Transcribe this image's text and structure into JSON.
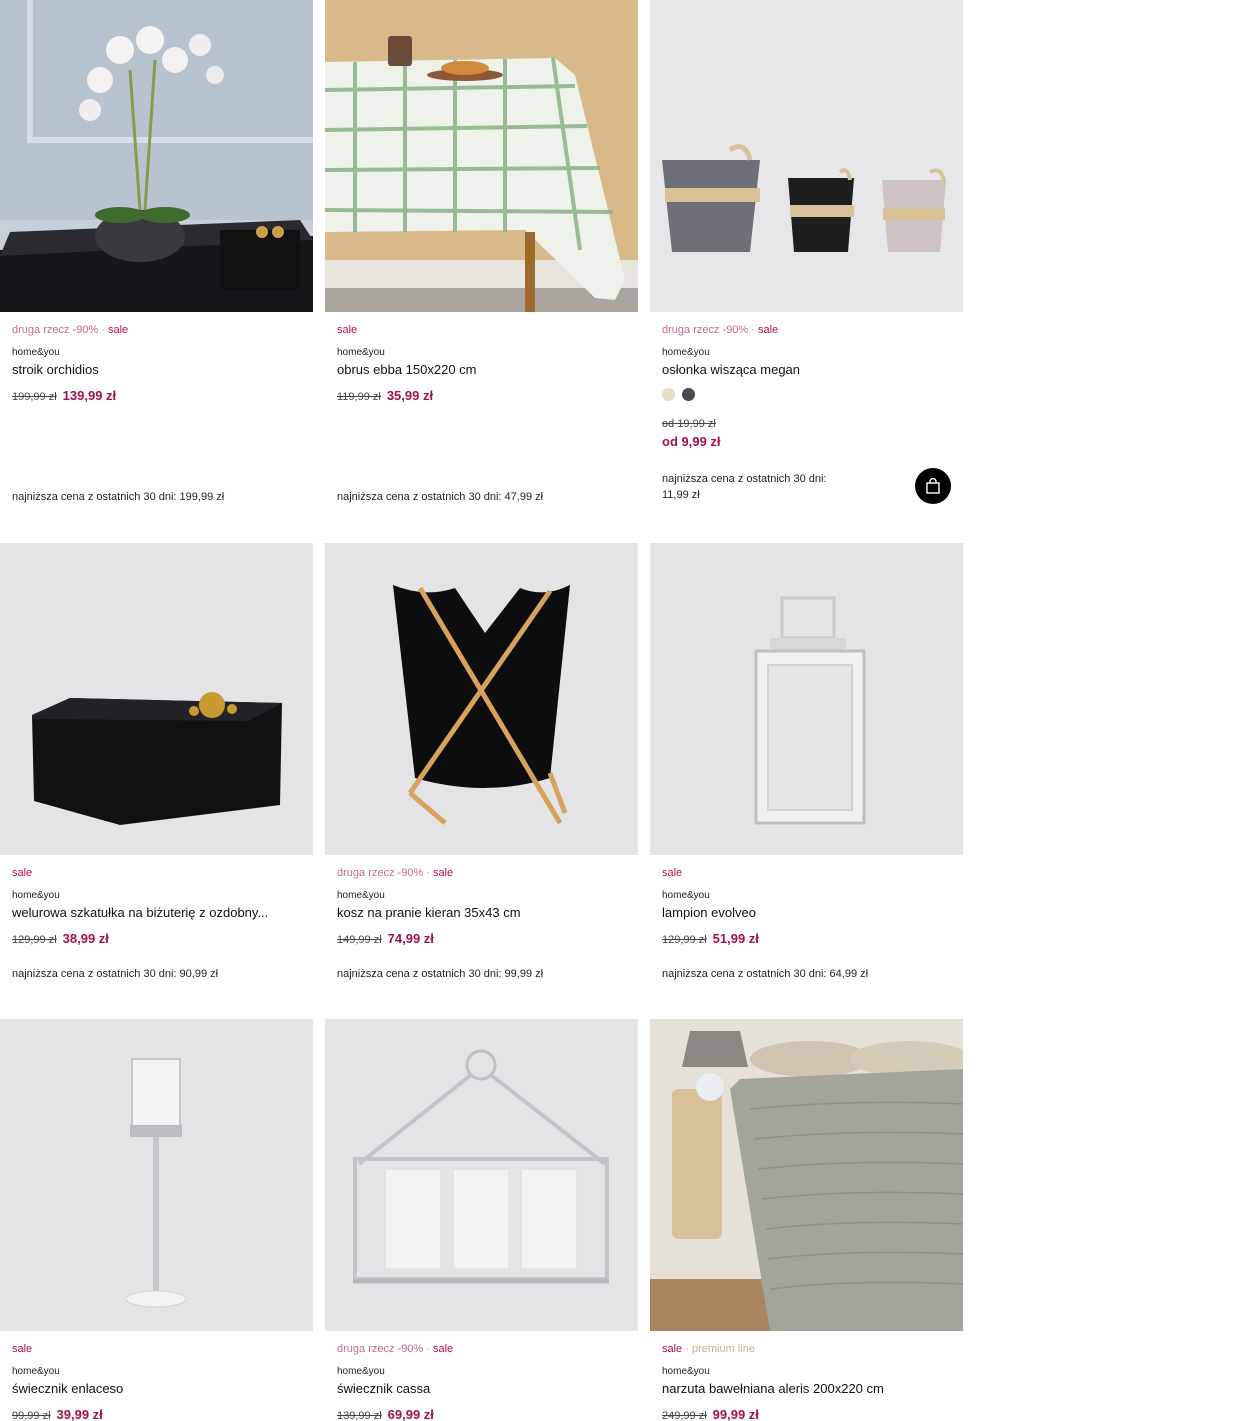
{
  "products": [
    {
      "promo": "druga rzecz -90%",
      "sep": " · ",
      "sale": "sale",
      "brand": "home&you",
      "name": "stroik orchidios",
      "old_price": "199,99 zł",
      "new_price": "139,99 zł",
      "lowest": "najniższa cena z ostatnich 30 dni: 199,99 zł"
    },
    {
      "sale": "sale",
      "brand": "home&you",
      "name": "obrus ebba 150x220 cm",
      "old_price": "119,99 zł",
      "new_price": "35,99 zł",
      "lowest": "najniższa cena z ostatnich 30 dni: 47,99 zł"
    },
    {
      "promo": "druga rzecz -90%",
      "sep": " · ",
      "sale": "sale",
      "brand": "home&you",
      "name": "osłonka wisząca megan",
      "swatches": [
        "#e6ddc6",
        "#4a4a4a"
      ],
      "old_price_prefix": "od",
      "old_price": "19,99 zł",
      "new_price": "od 9,99 zł",
      "lowest_line1": "najniższa cena z ostatnich 30 dni:",
      "lowest_line2": "11,99 zł",
      "cart_icon": "shopping-bag-icon"
    },
    {
      "sale": "sale",
      "brand": "home&you",
      "name": "welurowa szkatułka na biżuterię z ozdobny...",
      "old_price": "129,99 zł",
      "new_price": "38,99 zł",
      "lowest": "najniższa cena z ostatnich 30 dni: 90,99 zł"
    },
    {
      "promo": "druga rzecz -90%",
      "sep": " · ",
      "sale": "sale",
      "brand": "home&you",
      "name": "kosz na pranie kieran 35x43 cm",
      "old_price": "149,99 zł",
      "new_price": "74,99 zł",
      "lowest": "najniższa cena z ostatnich 30 dni: 99,99 zł"
    },
    {
      "sale": "sale",
      "brand": "home&you",
      "name": "lampion evolveo",
      "old_price": "129,99 zł",
      "new_price": "51,99 zł",
      "lowest": "najniższa cena z ostatnich 30 dni: 64,99 zł"
    },
    {
      "sale": "sale",
      "brand": "home&you",
      "name": "świecznik enlaceso",
      "old_price": "99,99 zł",
      "new_price": "39,99 zł"
    },
    {
      "promo": "druga rzecz -90%",
      "sep": " · ",
      "sale": "sale",
      "brand": "home&you",
      "name": "świecznik cassa",
      "old_price": "139,99 zł",
      "new_price": "69,99 zł"
    },
    {
      "sale": "sale",
      "sep": " · ",
      "premium": "premium line",
      "brand": "home&you",
      "name": "narzuta bawełniana aleris 200x220 cm",
      "old_price": "249,99 zł",
      "new_price": "99,99 zł"
    }
  ]
}
